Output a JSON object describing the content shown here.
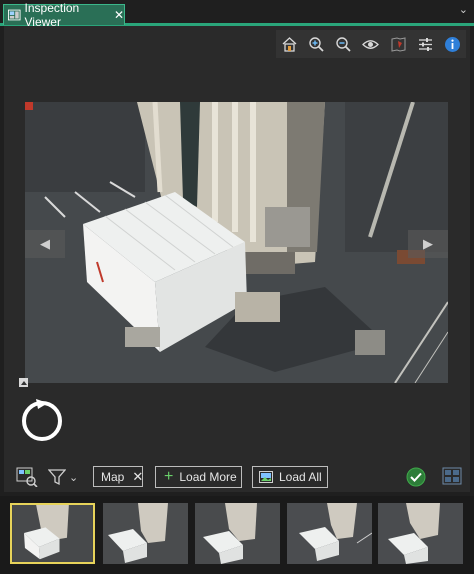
{
  "tab": {
    "title": "Inspection Viewer",
    "close_glyph": "✕",
    "icon": "inspection-viewer-icon"
  },
  "menu_glyph": "⌄",
  "toolbar": {
    "buttons": [
      {
        "name": "home-extent-icon"
      },
      {
        "name": "zoom-in-icon"
      },
      {
        "name": "zoom-out-icon"
      },
      {
        "name": "visibility-eye-icon"
      },
      {
        "name": "footprint-map-icon"
      },
      {
        "name": "adjust-settings-icon"
      },
      {
        "name": "info-icon"
      }
    ]
  },
  "viewer": {
    "prev_glyph": "◀",
    "next_glyph": "▶",
    "image_description_hidden": ""
  },
  "bottom": {
    "filter_chip_label": "Map",
    "filter_chip_close": "✕",
    "load_more_label": "Load More",
    "load_more_glyph": "+",
    "load_all_label": "Load All",
    "dropdown_glyph": "⌄"
  },
  "colors": {
    "accent": "#2aa57a",
    "selected_thumb": "#e7d35a",
    "ok_green": "#3fa94a",
    "info_blue": "#2f7fd8"
  },
  "thumbnails": {
    "count_visible": 5,
    "selected_index": 0
  }
}
